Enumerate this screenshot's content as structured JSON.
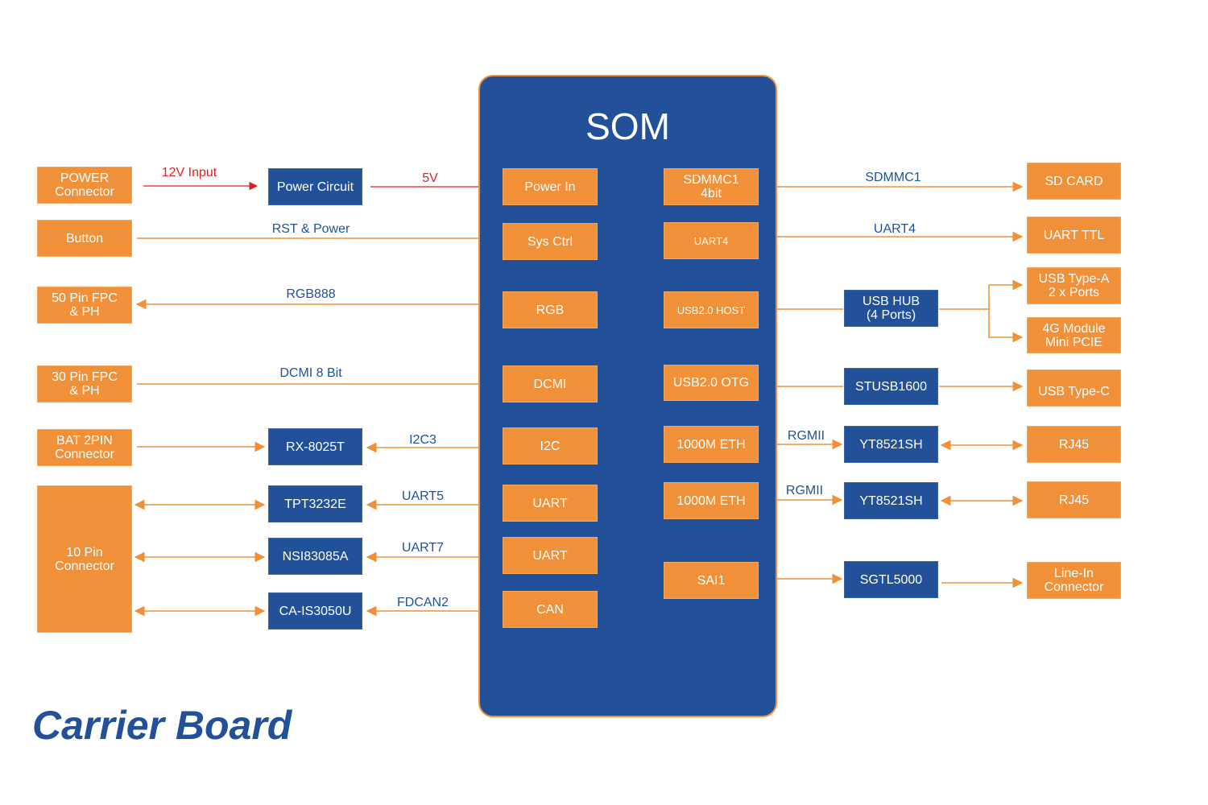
{
  "footer_title": "Carrier Board",
  "colors": {
    "orange": "#f0913a",
    "blue": "#22519a",
    "red": "#e02020"
  },
  "som": {
    "title": "SOM",
    "left_blocks": [
      "Power In",
      "Sys Ctrl",
      "RGB",
      "DCMI",
      "I2C",
      "UART",
      "UART",
      "CAN"
    ],
    "right_blocks": [
      "SDMMC1\n4bit",
      "UART4",
      "USB2.0 HOST",
      "USB2.0 OTG",
      "1000M ETH",
      "1000M ETH",
      "SAI1"
    ]
  },
  "left_connectors": [
    "POWER\nConnector",
    "Button",
    "50 Pin FPC\n& PH",
    "30 Pin FPC\n& PH",
    "BAT 2PIN\nConnector",
    "10 Pin\nConnector"
  ],
  "left_chips": [
    "Power Circuit",
    "RX-8025T",
    "TPT3232E",
    "NSI83085A",
    "CA-IS3050U"
  ],
  "right_chips": [
    "USB HUB\n(4 Ports)",
    "STUSB1600",
    "YT8521SH",
    "YT8521SH",
    "SGTL5000"
  ],
  "right_connectors": [
    "SD CARD",
    "UART TTL",
    "USB Type-A\n2 x Ports",
    "4G Module\nMini PCIE",
    "USB Type-C",
    "RJ45",
    "RJ45",
    "Line-In\nConnector"
  ],
  "signal_labels": {
    "left": [
      "12V Input",
      "5V",
      "RST & Power",
      "RGB888",
      "DCMI 8 Bit",
      "I2C3",
      "UART5",
      "UART7",
      "FDCAN2"
    ],
    "right": [
      "SDMMC1",
      "UART4",
      "RGMII",
      "RGMII"
    ]
  }
}
